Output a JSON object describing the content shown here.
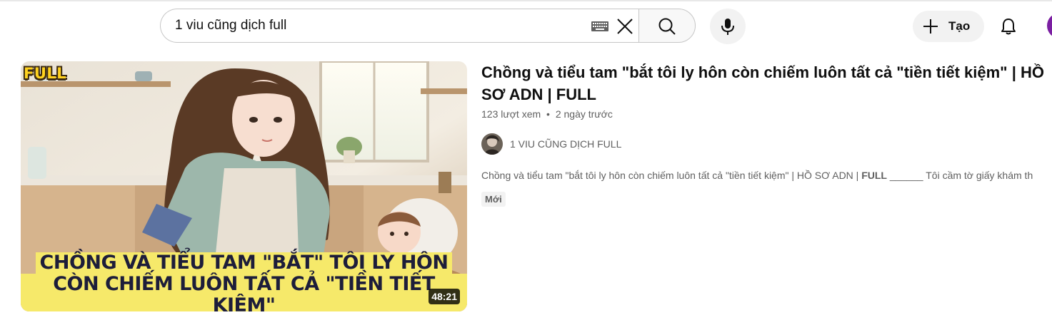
{
  "header": {
    "search_value": "1 viu cũng dịch full",
    "create_label": "Tạo",
    "icons": [
      "keyboard-icon",
      "close-icon",
      "search-icon",
      "mic-icon",
      "plus-icon",
      "bell-icon"
    ]
  },
  "video": {
    "title": "Chồng và tiểu tam \"bắt tôi ly hôn còn chiếm luôn tất cả \"tiền tiết kiệm\" | HỒ SƠ ADN | FULL",
    "views": "123 lượt xem",
    "age": "2 ngày trước",
    "dot": "•",
    "channel": "1 VIU CŨNG DỊCH FULL",
    "description_prefix": "Chồng và tiểu tam \"bắt tôi ly hôn còn chiếm luôn tất cả \"tiền tiết kiệm\" | HỒ SƠ ADN | ",
    "description_bold": "FULL",
    "description_suffix": " ______ Tôi cầm tờ giấy khám th",
    "badge": "Mới",
    "duration": "48:21",
    "thumb_badge": "FULL",
    "thumb_caption_1": "CHỒNG VÀ TIỂU TAM \"BẮT\" TÔI LY HÔN",
    "thumb_caption_2": "CÒN CHIẾM LUÔN TẤT CẢ \"TIỀN TIẾT KIỆM\""
  }
}
